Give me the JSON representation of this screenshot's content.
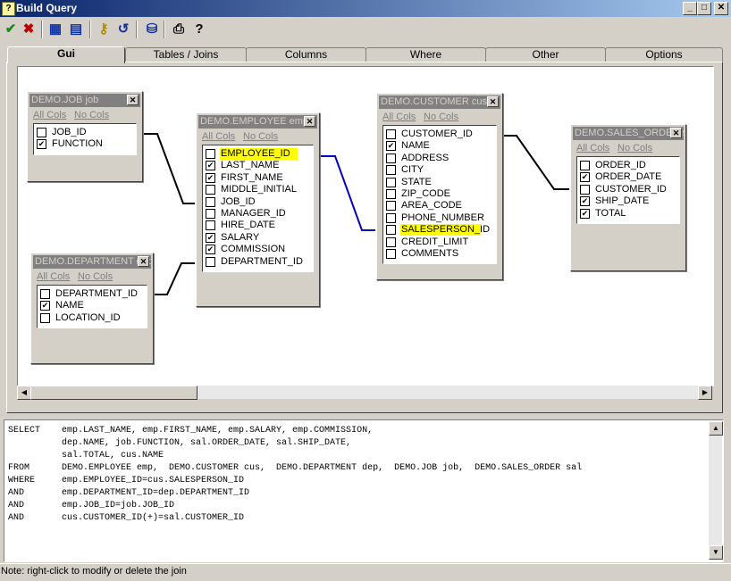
{
  "window": {
    "title": "Build Query",
    "app_icon": "?",
    "min": "_",
    "max": "□",
    "close": "✕"
  },
  "toolbar": [
    {
      "name": "ok-check-icon",
      "glyph": "✔",
      "color": "#1a8a1a"
    },
    {
      "name": "cancel-x-icon",
      "glyph": "✖",
      "color": "#c00000"
    },
    {
      "name": "add-table-icon",
      "glyph": "▦",
      "color": "#1030a0"
    },
    {
      "name": "table-layout-icon",
      "glyph": "▤",
      "color": "#1030a0"
    },
    {
      "name": "key-icon",
      "glyph": "⚷",
      "color": "#b08a00"
    },
    {
      "name": "refresh-icon",
      "glyph": "↺",
      "color": "#1030a0"
    },
    {
      "name": "database-icon",
      "glyph": "⛁",
      "color": "#1030a0"
    },
    {
      "name": "print-icon",
      "glyph": "⎙",
      "color": "#000000"
    },
    {
      "name": "help-icon",
      "glyph": "?",
      "color": "#000000"
    }
  ],
  "tabs": [
    "Gui",
    "Tables / Joins",
    "Columns",
    "Where",
    "Other",
    "Options"
  ],
  "links": {
    "all": "All Cols",
    "none": "No Cols"
  },
  "tables": [
    {
      "title": "DEMO.JOB job",
      "columns": [
        [
          "JOB_ID",
          false
        ],
        [
          "FUNCTION",
          true
        ]
      ]
    },
    {
      "title": "DEMO.DEPARTMENT dep",
      "columns": [
        [
          "DEPARTMENT_ID",
          false
        ],
        [
          "NAME",
          true
        ],
        [
          "LOCATION_ID",
          false
        ]
      ]
    },
    {
      "title": "DEMO.EMPLOYEE emp",
      "columns": [
        [
          "EMPLOYEE_ID",
          false,
          true
        ],
        [
          "LAST_NAME",
          true
        ],
        [
          "FIRST_NAME",
          true
        ],
        [
          "MIDDLE_INITIAL",
          false
        ],
        [
          "JOB_ID",
          false
        ],
        [
          "MANAGER_ID",
          false
        ],
        [
          "HIRE_DATE",
          false
        ],
        [
          "SALARY",
          true
        ],
        [
          "COMMISSION",
          true
        ],
        [
          "DEPARTMENT_ID",
          false
        ]
      ]
    },
    {
      "title": "DEMO.CUSTOMER cus",
      "columns": [
        [
          "CUSTOMER_ID",
          false
        ],
        [
          "NAME",
          true
        ],
        [
          "ADDRESS",
          false
        ],
        [
          "CITY",
          false
        ],
        [
          "STATE",
          false
        ],
        [
          "ZIP_CODE",
          false
        ],
        [
          "AREA_CODE",
          false
        ],
        [
          "PHONE_NUMBER",
          false
        ],
        [
          "SALESPERSON_ID",
          false,
          true
        ],
        [
          "CREDIT_LIMIT",
          false
        ],
        [
          "COMMENTS",
          false
        ]
      ]
    },
    {
      "title": "DEMO.SALES_ORDER sal",
      "columns": [
        [
          "ORDER_ID",
          false
        ],
        [
          "ORDER_DATE",
          true
        ],
        [
          "CUSTOMER_ID",
          false
        ],
        [
          "SHIP_DATE",
          true
        ],
        [
          "TOTAL",
          true
        ]
      ]
    }
  ],
  "sql": [
    "SELECT    emp.LAST_NAME, emp.FIRST_NAME, emp.SALARY, emp.COMMISSION,",
    "          dep.NAME, job.FUNCTION, sal.ORDER_DATE, sal.SHIP_DATE,",
    "          sal.TOTAL, cus.NAME",
    "FROM      DEMO.EMPLOYEE emp,  DEMO.CUSTOMER cus,  DEMO.DEPARTMENT dep,  DEMO.JOB job,  DEMO.SALES_ORDER sal",
    "WHERE     emp.EMPLOYEE_ID=cus.SALESPERSON_ID",
    "AND       emp.DEPARTMENT_ID=dep.DEPARTMENT_ID",
    "AND       emp.JOB_ID=job.JOB_ID",
    "AND       cus.CUSTOMER_ID(+)=sal.CUSTOMER_ID"
  ],
  "status": "Note: right-click to modify or delete the join",
  "colors": {
    "highlight": "#ffff00",
    "join_selected": "#0000c0",
    "join": "#000000"
  }
}
